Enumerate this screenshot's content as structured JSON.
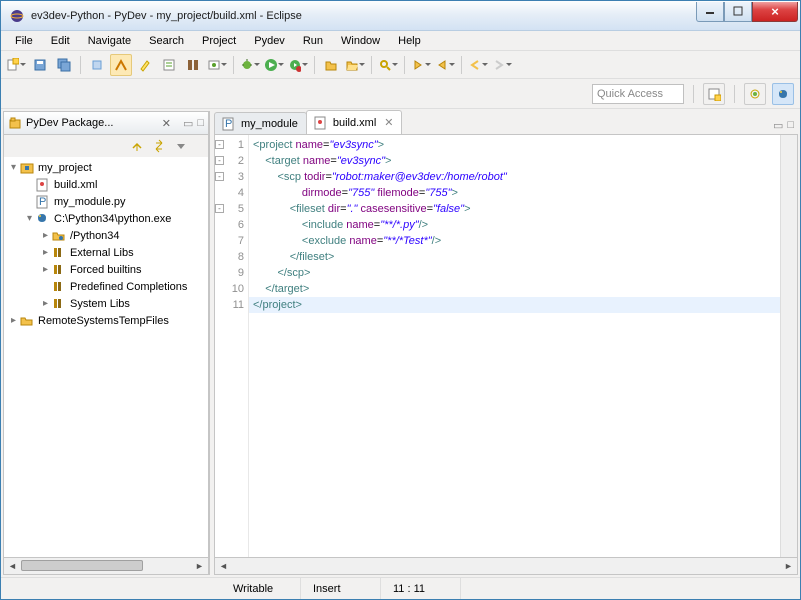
{
  "window": {
    "title": "ev3dev-Python - PyDev - my_project/build.xml - Eclipse"
  },
  "menu": [
    "File",
    "Edit",
    "Navigate",
    "Search",
    "Project",
    "Pydev",
    "Run",
    "Window",
    "Help"
  ],
  "quick_access": "Quick Access",
  "package_explorer": {
    "title": "PyDev Package...",
    "tree": [
      {
        "d": 0,
        "tw": "▾",
        "icon": "project",
        "label": "my_project"
      },
      {
        "d": 1,
        "tw": "",
        "icon": "ant",
        "label": "build.xml"
      },
      {
        "d": 1,
        "tw": "",
        "icon": "py",
        "label": "my_module.py"
      },
      {
        "d": 1,
        "tw": "▾",
        "icon": "pyexe",
        "label": "C:\\Python34\\python.exe"
      },
      {
        "d": 2,
        "tw": "▸",
        "icon": "pyfolder",
        "label": "/Python34"
      },
      {
        "d": 2,
        "tw": "▸",
        "icon": "lib",
        "label": "External Libs"
      },
      {
        "d": 2,
        "tw": "▸",
        "icon": "lib",
        "label": "Forced builtins"
      },
      {
        "d": 2,
        "tw": "",
        "icon": "lib",
        "label": "Predefined Completions"
      },
      {
        "d": 2,
        "tw": "▸",
        "icon": "lib",
        "label": "System Libs"
      },
      {
        "d": 0,
        "tw": "▸",
        "icon": "folder",
        "label": "RemoteSystemsTempFiles"
      }
    ]
  },
  "tabs": [
    {
      "icon": "py",
      "label": "my_module",
      "active": false
    },
    {
      "icon": "ant",
      "label": "build.xml",
      "active": true
    }
  ],
  "code_lines": [
    {
      "n": 1,
      "fold": "-",
      "html": "<span class='t-tag'>&lt;project</span> <span class='t-attr'>name</span>=<span class='t-str'>\"ev3sync\"</span><span class='t-tag'>&gt;</span>"
    },
    {
      "n": 2,
      "fold": "-",
      "html": "    <span class='t-tag'>&lt;target</span> <span class='t-attr'>name</span>=<span class='t-str'>\"ev3sync\"</span><span class='t-tag'>&gt;</span>"
    },
    {
      "n": 3,
      "fold": "-",
      "html": "        <span class='t-tag'>&lt;scp</span> <span class='t-attr'>todir</span>=<span class='t-str'>\"robot:maker@ev3dev:/home/robot\"</span>"
    },
    {
      "n": 4,
      "fold": "",
      "html": "                <span class='t-attr'>dirmode</span>=<span class='t-str'>\"755\"</span> <span class='t-attr'>filemode</span>=<span class='t-str'>\"755\"</span><span class='t-tag'>&gt;</span>"
    },
    {
      "n": 5,
      "fold": "-",
      "html": "            <span class='t-tag'>&lt;fileset</span> <span class='t-attr'>dir</span>=<span class='t-str'>\".\"</span> <span class='t-attr'>casesensitive</span>=<span class='t-str'>\"false\"</span><span class='t-tag'>&gt;</span>"
    },
    {
      "n": 6,
      "fold": "",
      "html": "                <span class='t-tag'>&lt;include</span> <span class='t-attr'>name</span>=<span class='t-str'>\"**/*.py\"</span><span class='t-tag'>/&gt;</span>"
    },
    {
      "n": 7,
      "fold": "",
      "html": "                <span class='t-tag'>&lt;exclude</span> <span class='t-attr'>name</span>=<span class='t-str'>\"**/*Test*\"</span><span class='t-tag'>/&gt;</span>"
    },
    {
      "n": 8,
      "fold": "",
      "html": "            <span class='t-tag'>&lt;/fileset&gt;</span>"
    },
    {
      "n": 9,
      "fold": "",
      "html": "        <span class='t-tag'>&lt;/scp&gt;</span>"
    },
    {
      "n": 10,
      "fold": "",
      "html": "    <span class='t-tag'>&lt;/target&gt;</span>"
    },
    {
      "n": 11,
      "fold": "",
      "html": "<span class='t-tag'>&lt;/project&gt;</span>",
      "cursor": true
    }
  ],
  "status": {
    "writable": "Writable",
    "insert": "Insert",
    "pos": "11 : 11"
  }
}
